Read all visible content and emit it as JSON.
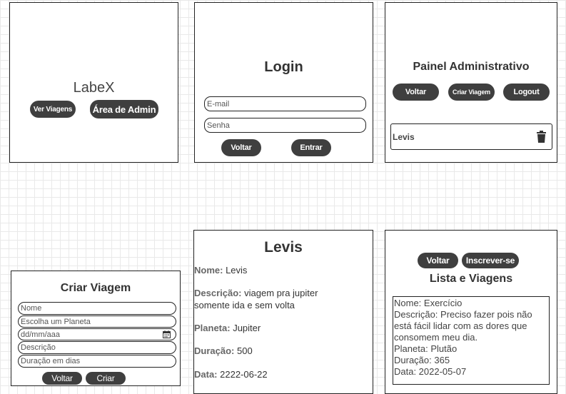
{
  "home": {
    "brand": "LabeX",
    "see_trips_label": "Ver Viagens",
    "admin_area_label": "Área de Admin"
  },
  "login": {
    "title": "Login",
    "email_placeholder": "E-mail",
    "password_placeholder": "Senha",
    "back_label": "Voltar",
    "enter_label": "Entrar"
  },
  "admin": {
    "title": "Painel Administrativo",
    "back_label": "Voltar",
    "create_trip_label": "Criar Viagem",
    "logout_label": "Logout",
    "trip_name": "Levis",
    "delete_icon": "trash-icon"
  },
  "create_trip": {
    "title": "Criar Viagem",
    "name_placeholder": "Nome",
    "planet_placeholder": "Escolha um Planeta",
    "date_placeholder": "dd/mm/aaa",
    "description_placeholder": "Descrição",
    "duration_placeholder": "Duração em dias",
    "back_label": "Voltar",
    "create_label": "Criar",
    "calendar_icon": "calendar-icon"
  },
  "trip_detail": {
    "title": "Levis",
    "name_label": "Nome:",
    "name_value": "Levis",
    "description_label": "Descrição:",
    "description_value_1": "viagem pra jupiter",
    "description_value_2": "somente ida e sem volta",
    "planet_label": "Planeta:",
    "planet_value": "Jupiter",
    "duration_label": "Duração:",
    "duration_value": "500",
    "date_label": "Data:",
    "date_value": "2222-06-22"
  },
  "trip_list": {
    "back_label": "Voltar",
    "subscribe_label": "Inscrever-se",
    "title": "Lista e Viagens",
    "card_lines": [
      "Nome: Exercício",
      "Descrição: Preciso fazer pois não",
      "está fácil lidar com as dores que",
      "consomem meu dia.",
      "Planeta: Plutão",
      "Duração: 365",
      "Data: 2022-05-07"
    ]
  }
}
